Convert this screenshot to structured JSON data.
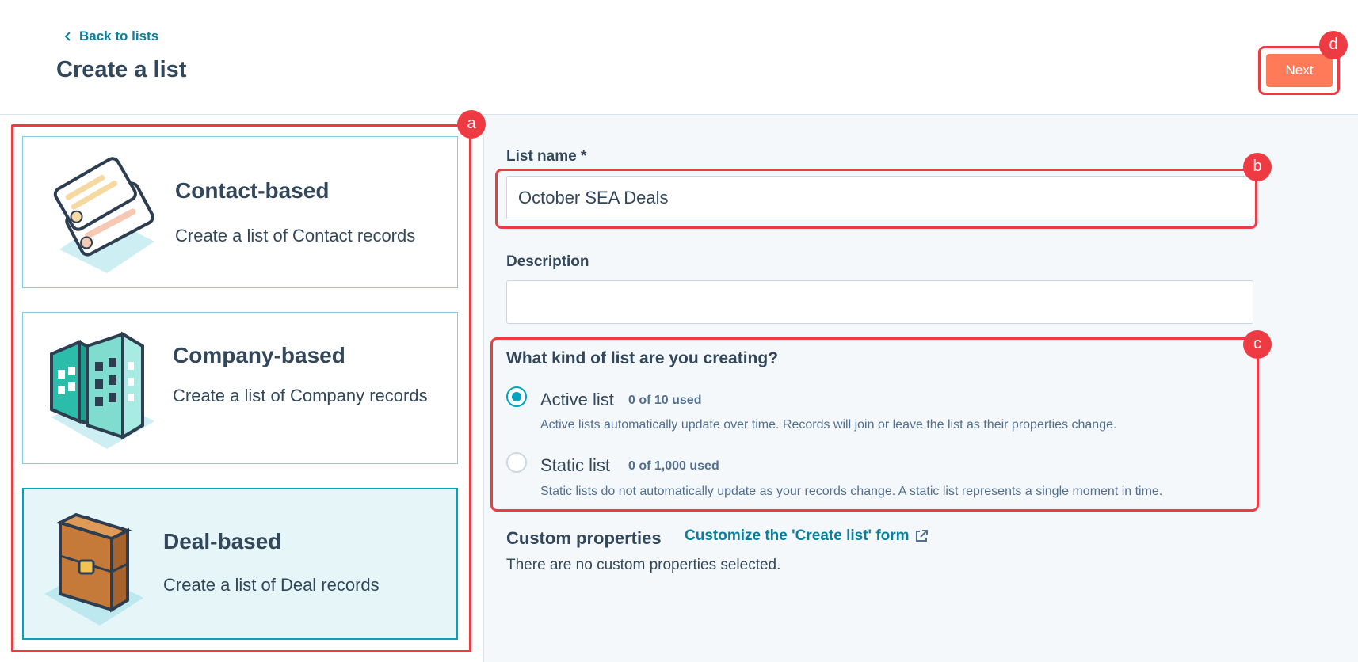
{
  "header": {
    "back_label": "Back to lists",
    "title": "Create a list",
    "next_label": "Next"
  },
  "list_types": [
    {
      "title": "Contact-based",
      "description": "Create a list of Contact records",
      "icon": "contact-cards-illustration",
      "selected": false
    },
    {
      "title": "Company-based",
      "description": "Create a list of Company records",
      "icon": "buildings-illustration",
      "selected": false
    },
    {
      "title": "Deal-based",
      "description": "Create a list of Deal records",
      "icon": "briefcase-illustration",
      "selected": true
    }
  ],
  "form": {
    "name_label": "List name *",
    "name_value": "October SEA Deals",
    "description_label": "Description",
    "description_value": "",
    "kind_question": "What kind of list are you creating?",
    "options": [
      {
        "title": "Active list",
        "usage": "0 of 10 used",
        "help": "Active lists automatically update over time. Records will join or leave the list as their properties change.",
        "checked": true
      },
      {
        "title": "Static list",
        "usage": "0 of 1,000 used",
        "help": "Static lists do not automatically update as your records change. A static list represents a single moment in time.",
        "checked": false
      }
    ],
    "custom_title": "Custom properties",
    "custom_link": "Customize the 'Create list' form",
    "custom_empty": "There are no custom properties selected."
  },
  "annotations": [
    "a",
    "b",
    "c",
    "d"
  ],
  "colors": {
    "accent": "#00a4bd",
    "cta": "#ff7a59",
    "link": "#0a7e9d",
    "annotation": "#ee3a43",
    "text": "#33475b"
  }
}
